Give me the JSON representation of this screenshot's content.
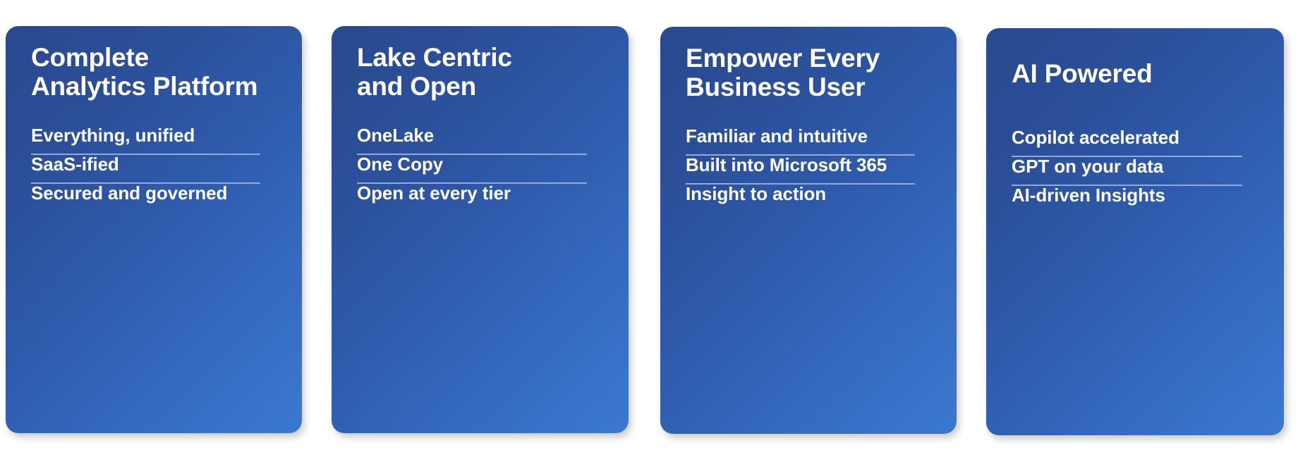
{
  "background_color": "#ffffff",
  "card_gradient": {
    "from": "#29498F",
    "to": "#3B78D0",
    "angle": "135deg"
  },
  "divider_color": "#93AAD6",
  "text_color": "#ffffff",
  "cards": [
    {
      "title": "Complete\nAnalytics Platform",
      "features": [
        "Everything, unified",
        "SaaS-ified",
        "Secured and governed"
      ]
    },
    {
      "title": "Lake Centric\nand Open",
      "features": [
        "OneLake",
        "One Copy",
        "Open at every tier"
      ]
    },
    {
      "title": "Empower Every\nBusiness User",
      "features": [
        "Familiar and intuitive",
        "Built into Microsoft 365",
        "Insight to action"
      ]
    },
    {
      "title": "AI Powered",
      "features": [
        "Copilot accelerated",
        "GPT on your data",
        "AI-driven Insights"
      ]
    }
  ]
}
